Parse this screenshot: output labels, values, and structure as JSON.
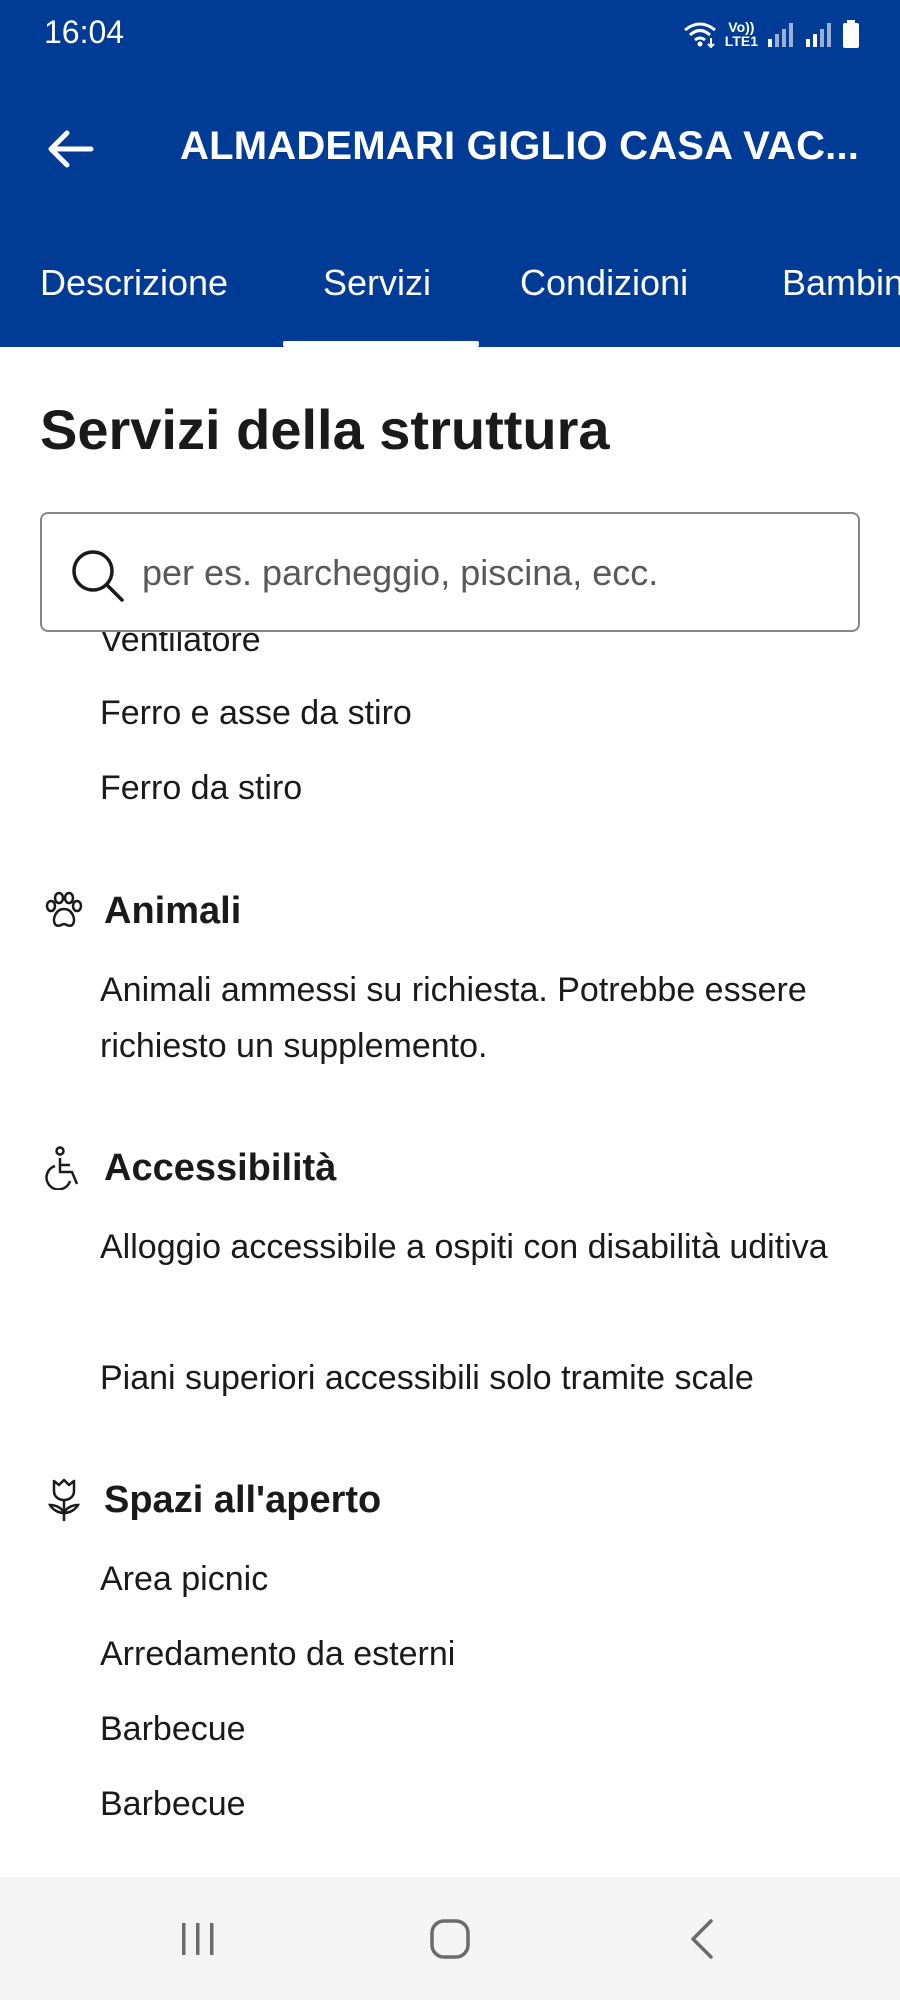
{
  "status": {
    "time": "16:04",
    "lte_line1": "Vo))",
    "lte_line2": "LTE1"
  },
  "app_bar": {
    "title": "ALMADEMARI GIGLIO CASA VAC..."
  },
  "tabs": [
    {
      "label": "Descrizione"
    },
    {
      "label": "Servizi"
    },
    {
      "label": "Condizioni"
    },
    {
      "label": "Bambini"
    }
  ],
  "content": {
    "page_title": "Servizi della struttura",
    "search_placeholder": "per es. parcheggio, piscina, ecc.",
    "clipped_item": "Ventilatore",
    "items_top": [
      "Ferro e asse da stiro",
      "Ferro da stiro"
    ],
    "sections": [
      {
        "title": "Animali",
        "icon": "paw-icon",
        "items": [
          "Animali ammessi su richiesta. Potrebbe essere richiesto un supplemento."
        ]
      },
      {
        "title": "Accessibilità",
        "icon": "wheelchair-icon",
        "items": [
          "Alloggio accessibile a ospiti con disabilità uditiva",
          "Piani superiori accessibili solo tramite scale"
        ]
      },
      {
        "title": "Spazi all'aperto",
        "icon": "flower-icon",
        "items": [
          "Area picnic",
          "Arredamento da esterni",
          "Barbecue",
          "Barbecue"
        ]
      }
    ]
  },
  "colors": {
    "brand_blue": "#003b95",
    "text": "#1a1a1a",
    "placeholder": "#595959",
    "nav_bg": "#f4f4f4"
  }
}
